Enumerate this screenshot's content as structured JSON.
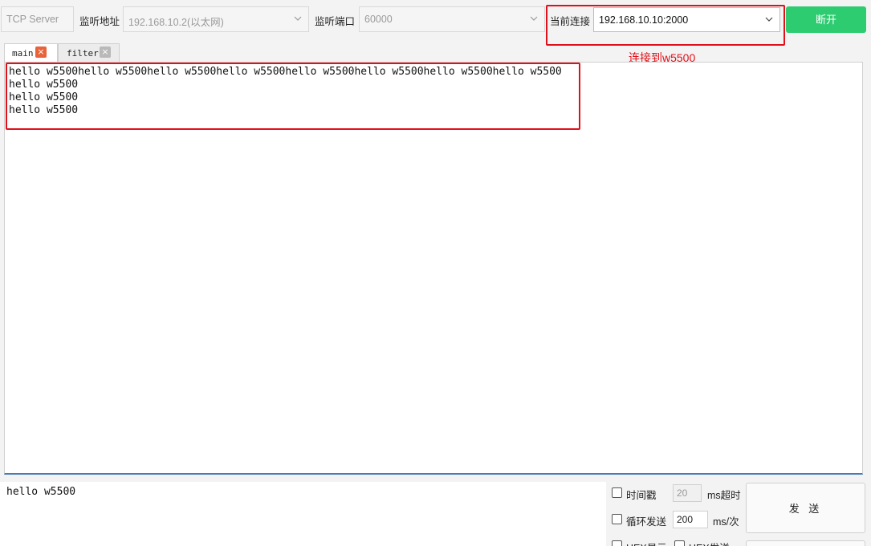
{
  "toolbar": {
    "protocol": "TCP Server",
    "listen_addr_label": "监听地址",
    "listen_addr": "192.168.10.2(以太网)",
    "listen_port_label": "监听端口",
    "listen_port": "60000",
    "current_conn_label": "当前连接",
    "current_conn": "192.168.10.10:2000",
    "disconnect_label": "断开"
  },
  "annotation": "连接到w5500",
  "tabs": [
    {
      "label": "main",
      "close": "×",
      "active": true
    },
    {
      "label": "filter",
      "close": "×",
      "active": false
    }
  ],
  "receive": {
    "lines": [
      "hello w5500hello w5500hello w5500hello w5500hello w5500hello w5500hello w5500hello w5500",
      "hello w5500",
      "hello w5500",
      "hello w5500"
    ]
  },
  "send": {
    "text": "hello w5500",
    "timestamp_label": "时间戳",
    "timeout_value": "20",
    "timeout_unit": "ms超时",
    "loop_label": "循环发送",
    "loop_value": "200",
    "loop_unit": "ms/次",
    "hex_display_label": "HEX显示",
    "hex_send_label": "HEX发送",
    "send_label": "发 送"
  },
  "colors": {
    "accent_green": "#2ecc71",
    "highlight_red": "#e0101a",
    "tab_close_active": "#e8633a"
  },
  "icons": [
    "chevron-down-icon",
    "close-icon",
    "checkbox"
  ]
}
